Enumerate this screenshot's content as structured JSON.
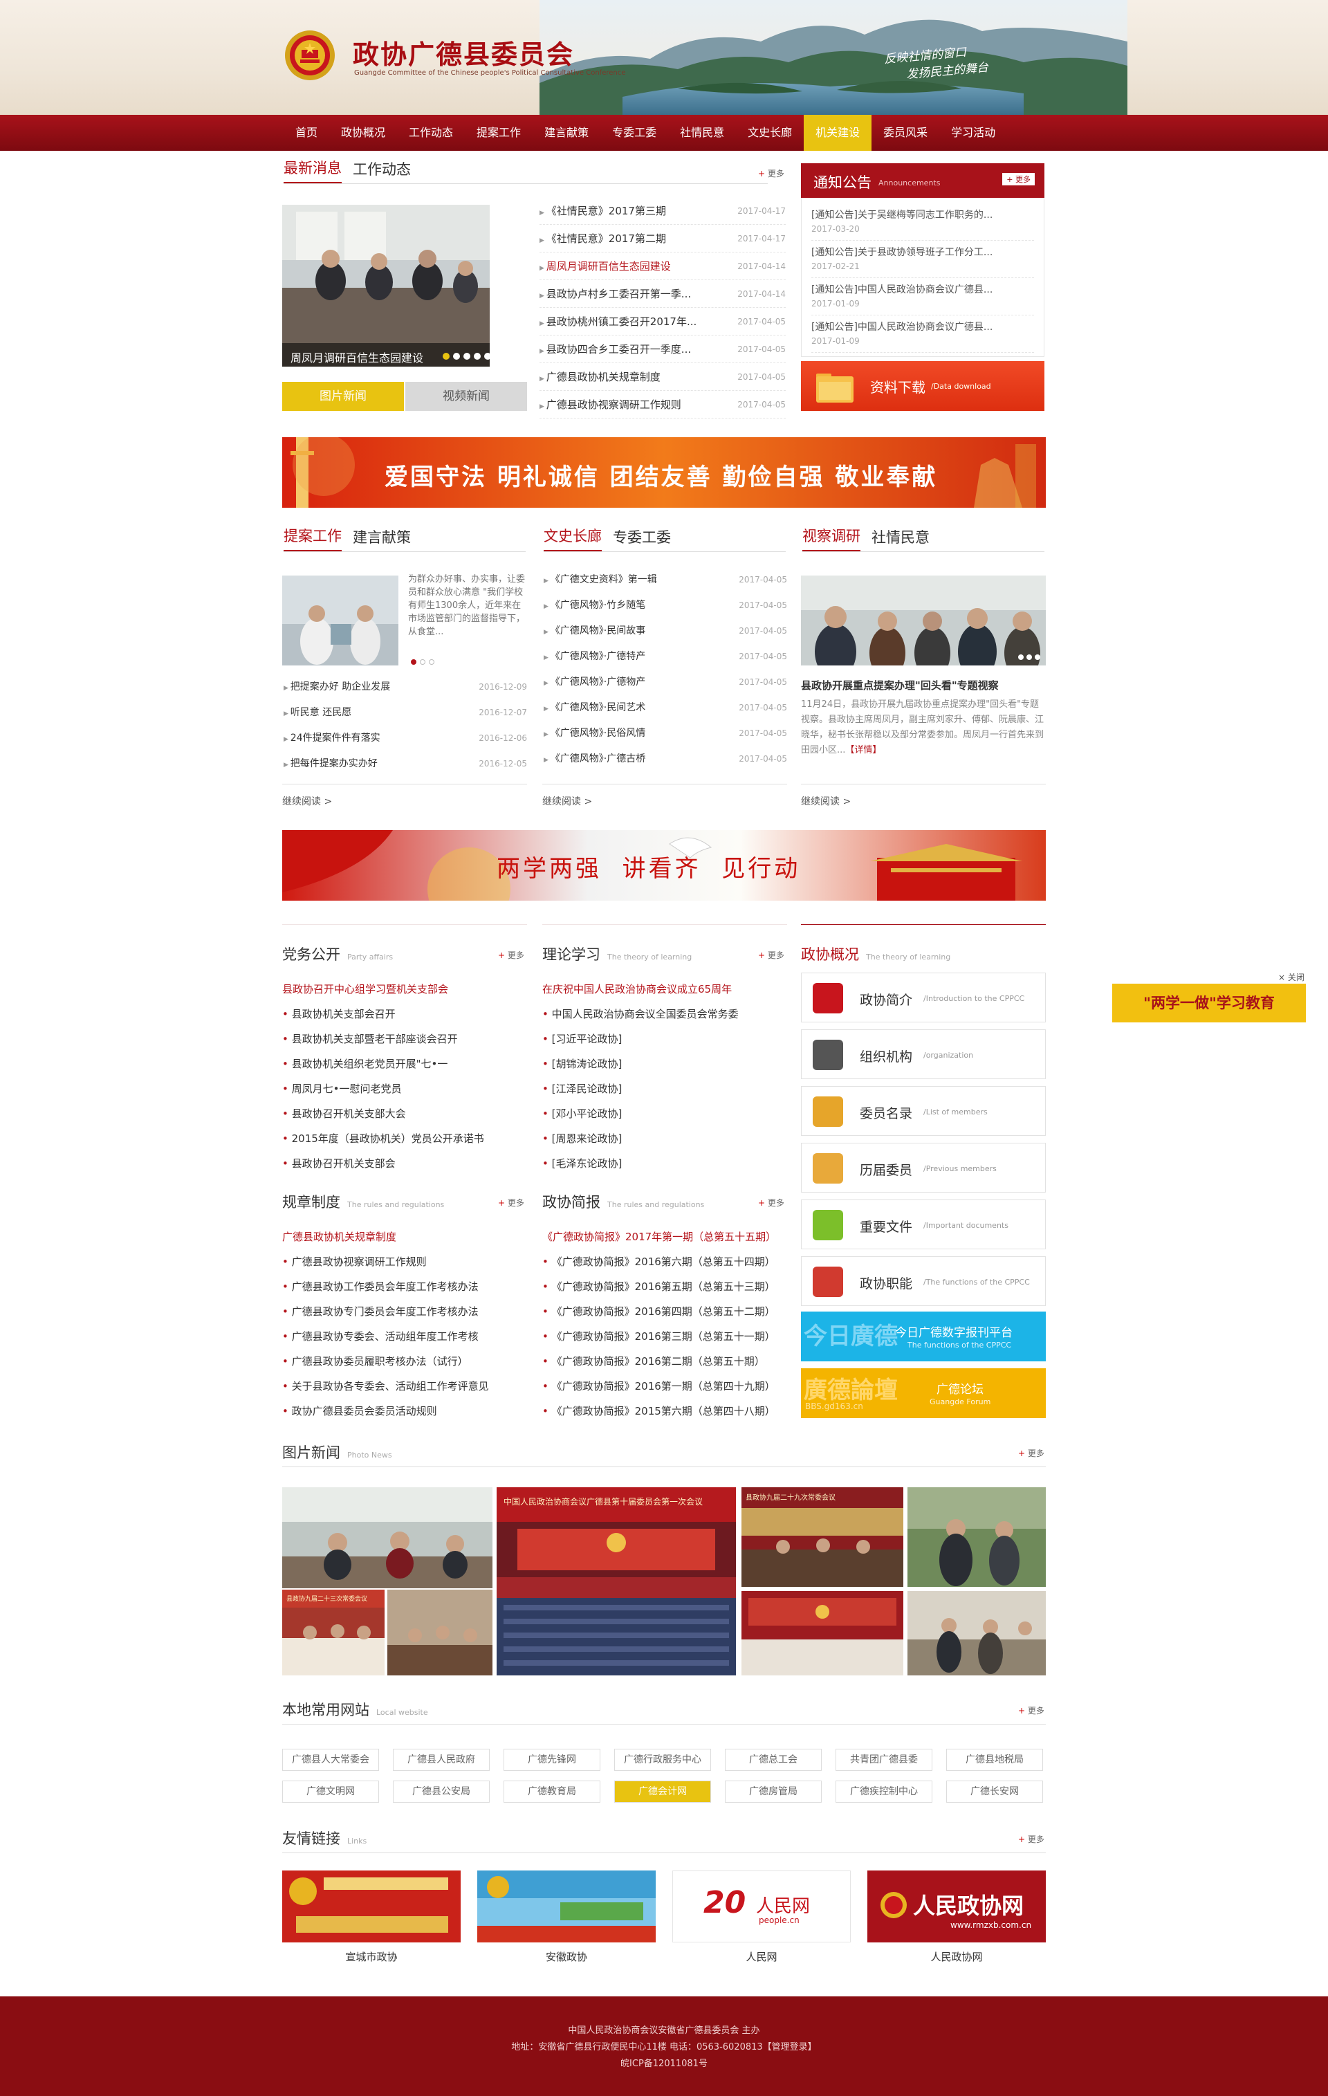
{
  "header": {
    "title": "政协广德县委员会",
    "subtitle": "Guangde Committee of the Chinese people's Political Consultative Conference",
    "slogan1": "反映社情的窗口",
    "slogan2": "发扬民主的舞台"
  },
  "nav": [
    "首页",
    "政协概况",
    "工作动态",
    "提案工作",
    "建言献策",
    "专委工委",
    "社情民意",
    "文史长廊",
    "机关建设",
    "委员风采",
    "学习活动"
  ],
  "news": {
    "tab1": "最新消息",
    "tab2": "工作动态",
    "more": "更多",
    "caption": "周凤月调研百信生态园建设",
    "btn1": "图片新闻",
    "btn2": "视频新闻",
    "items": [
      {
        "t": "《社情民意》2017第三期",
        "d": "2017-04-17"
      },
      {
        "t": "《社情民意》2017第二期",
        "d": "2017-04-17"
      },
      {
        "t": "周凤月调研百信生态园建设",
        "d": "2017-04-14"
      },
      {
        "t": "县政协卢村乡工委召开第一季...",
        "d": "2017-04-14"
      },
      {
        "t": "县政协桃州镇工委召开2017年...",
        "d": "2017-04-05"
      },
      {
        "t": "县政协四合乡工委召开一季度...",
        "d": "2017-04-05"
      },
      {
        "t": "广德县政协机关规章制度",
        "d": "2017-04-05"
      },
      {
        "t": "广德县政协视察调研工作规则",
        "d": "2017-04-05"
      }
    ]
  },
  "notice": {
    "title": "通知公告",
    "en": "Announcements",
    "more": "更多",
    "items": [
      {
        "t": "[通知公告]关于吴继梅等同志工作职务的...",
        "d": "2017-03-20"
      },
      {
        "t": "[通知公告]关于县政协领导班子工作分工...",
        "d": "2017-02-21"
      },
      {
        "t": "[通知公告]中国人民政治协商会议广德县...",
        "d": "2017-01-09"
      },
      {
        "t": "[通知公告]中国人民政治协商会议广德县...",
        "d": "2017-01-09"
      }
    ],
    "download": "资料下载",
    "download_en": "/Data download"
  },
  "banner1": "爱国守法 明礼诚信 团结友善 勤俭自强 敬业奉献",
  "col1": {
    "tab1": "提案工作",
    "tab2": "建言献策",
    "summary": "为群众办好事、办实事，让委员和群众放心满意 \"我们学校有师生1300余人，近年来在市场监管部门的监督指导下，从食堂...",
    "items": [
      {
        "t": "把提案办好 助企业发展",
        "d": "2016-12-09"
      },
      {
        "t": "听民意 还民愿",
        "d": "2016-12-07"
      },
      {
        "t": "24件提案件件有落实",
        "d": "2016-12-06"
      },
      {
        "t": "把每件提案办实办好",
        "d": "2016-12-05"
      }
    ],
    "more": "继续阅读 >"
  },
  "col2": {
    "tab1": "文史长廊",
    "tab2": "专委工委",
    "items": [
      {
        "t": "《广德文史资料》第一辑",
        "d": "2017-04-05"
      },
      {
        "t": "《广德风物》·竹乡随笔",
        "d": "2017-04-05"
      },
      {
        "t": "《广德风物》·民间故事",
        "d": "2017-04-05"
      },
      {
        "t": "《广德风物》·广德特产",
        "d": "2017-04-05"
      },
      {
        "t": "《广德风物》·广德物产",
        "d": "2017-04-05"
      },
      {
        "t": "《广德风物》·民间艺术",
        "d": "2017-04-05"
      },
      {
        "t": "《广德风物》·民俗风情",
        "d": "2017-04-05"
      },
      {
        "t": "《广德风物》·广德古桥",
        "d": "2017-04-05"
      }
    ],
    "more": "继续阅读 >"
  },
  "col3": {
    "tab1": "视察调研",
    "tab2": "社情民意",
    "headline": "县政协开展重点提案办理\"回头看\"专题视察",
    "body": "11月24日，县政协开展九届政协重点提案办理\"回头看\"专题视察。县政协主席周凤月，副主席刘家升、傅郁、阮晨康、江晓华，秘书长张帮稳以及部分常委参加。周凤月一行首先来到田园小区...",
    "detail": "【详情】",
    "more": "继续阅读 >"
  },
  "banner2": "两学两强  讲看齐  见行动",
  "party": {
    "title": "党务公开",
    "en": "Party affairs",
    "more": "更多",
    "items": [
      "县政协召开中心组学习暨机关支部会",
      "县政协机关支部会召开",
      "县政协机关支部暨老干部座谈会召开",
      "县政协机关组织老党员开展\"七•一",
      "周凤月七•一慰问老党员",
      "县政协召开机关支部大会",
      "2015年度（县政协机关）党员公开承诺书",
      "县政协召开机关支部会"
    ]
  },
  "theory": {
    "title": "理论学习",
    "en": "The theory of learning",
    "more": "更多",
    "items": [
      "在庆祝中国人民政治协商会议成立65周年",
      "中国人民政治协商会议全国委员会常务委",
      "[习近平论政协]",
      "[胡锦涛论政协]",
      "[江泽民论政协]",
      "[邓小平论政协]",
      "[周恩来论政协]",
      "[毛泽东论政协]"
    ]
  },
  "rules": {
    "title": "规章制度",
    "en": "The rules and regulations",
    "more": "更多",
    "items": [
      "广德县政协机关规章制度",
      "广德县政协视察调研工作规则",
      "广德县政协工作委员会年度工作考核办法",
      "广德县政协专门委员会年度工作考核办法",
      "广德县政协专委会、活动组年度工作考核",
      "广德县政协委员履职考核办法（试行）",
      "关于县政协各专委会、活动组工作考评意见",
      "政协广德县委员会委员活动规则"
    ]
  },
  "brief": {
    "title": "政协简报",
    "en": "The rules and regulations",
    "more": "更多",
    "items": [
      "《广德政协简报》2017年第一期（总第五十五期）",
      "《广德政协简报》2016第六期（总第五十四期）",
      "《广德政协简报》2016第五期（总第五十三期）",
      "《广德政协简报》2016第四期（总第五十二期）",
      "《广德政协简报》2016第三期（总第五十一期）",
      "《广德政协简报》2016第二期（总第五十期）",
      "《广德政协简报》2016第一期（总第四十九期）",
      "《广德政协简报》2015第六期（总第四十八期）"
    ]
  },
  "overview": {
    "title": "政协概况",
    "en": "The theory of learning",
    "items": [
      {
        "t": "政协简介",
        "e": "/Introduction to the CPPCC",
        "icon": "emblem-icon"
      },
      {
        "t": "组织机构",
        "e": "/organization",
        "icon": "phone-icon"
      },
      {
        "t": "委员名录",
        "e": "/List of members",
        "icon": "notebook-icon"
      },
      {
        "t": "历届委员",
        "e": "/Previous members",
        "icon": "address-book-icon"
      },
      {
        "t": "重要文件",
        "e": "/Important documents",
        "icon": "folder-icon"
      },
      {
        "t": "政协职能",
        "e": "/The functions of the CPPCC",
        "icon": "books-icon"
      }
    ],
    "box1": "今日广德数字报刊平台",
    "box1_en": "The functions of the CPPCC",
    "box1_bg": "今日廣德",
    "box2": "广德论坛",
    "box2_en": "Guangde Forum",
    "box2_bg": "廣德論壇",
    "box2_url": "BBS.gd163.cn"
  },
  "float": {
    "close": "× 关闭",
    "label": "\"两学一做\"学习教育"
  },
  "photo": {
    "title": "图片新闻",
    "en": "Photo News",
    "more": "更多",
    "big_heading": "中国人民政治协商会议广德县第十届委员会第一次会议",
    "mid_heading": "县政协九届二十九次常委会议",
    "small_heading": "县政协九届二十三次常委会议"
  },
  "local": {
    "title": "本地常用网站",
    "en": "Local website",
    "more": "更多",
    "row1": [
      "广德县人大常委会",
      "广德县人民政府",
      "广德先锋网",
      "广德行政服务中心",
      "广德总工会",
      "共青团广德县委",
      "广德县地税局"
    ],
    "row2": [
      "广德文明网",
      "广德县公安局",
      "广德教育局",
      "广德会计网",
      "广德房管局",
      "广德疾控制中心",
      "广德长安网"
    ]
  },
  "links": {
    "title": "友情链接",
    "en": "Links",
    "more": "更多",
    "items": [
      "宣城市政协",
      "安徽政协",
      "人民网",
      "人民政协网"
    ],
    "people_logo": "人民网",
    "people_url": "people.cn",
    "rmzx_logo": "人民政协网",
    "rmzx_url": "www.rmzxb.com.cn"
  },
  "footer": {
    "line1": "中国人民政治协商会议安徽省广德县委员会 主办",
    "line2": "地址：安徽省广德县行政便民中心11楼 电话：0563-6020813【管理登录】",
    "line3": "皖ICP备12011081号"
  }
}
